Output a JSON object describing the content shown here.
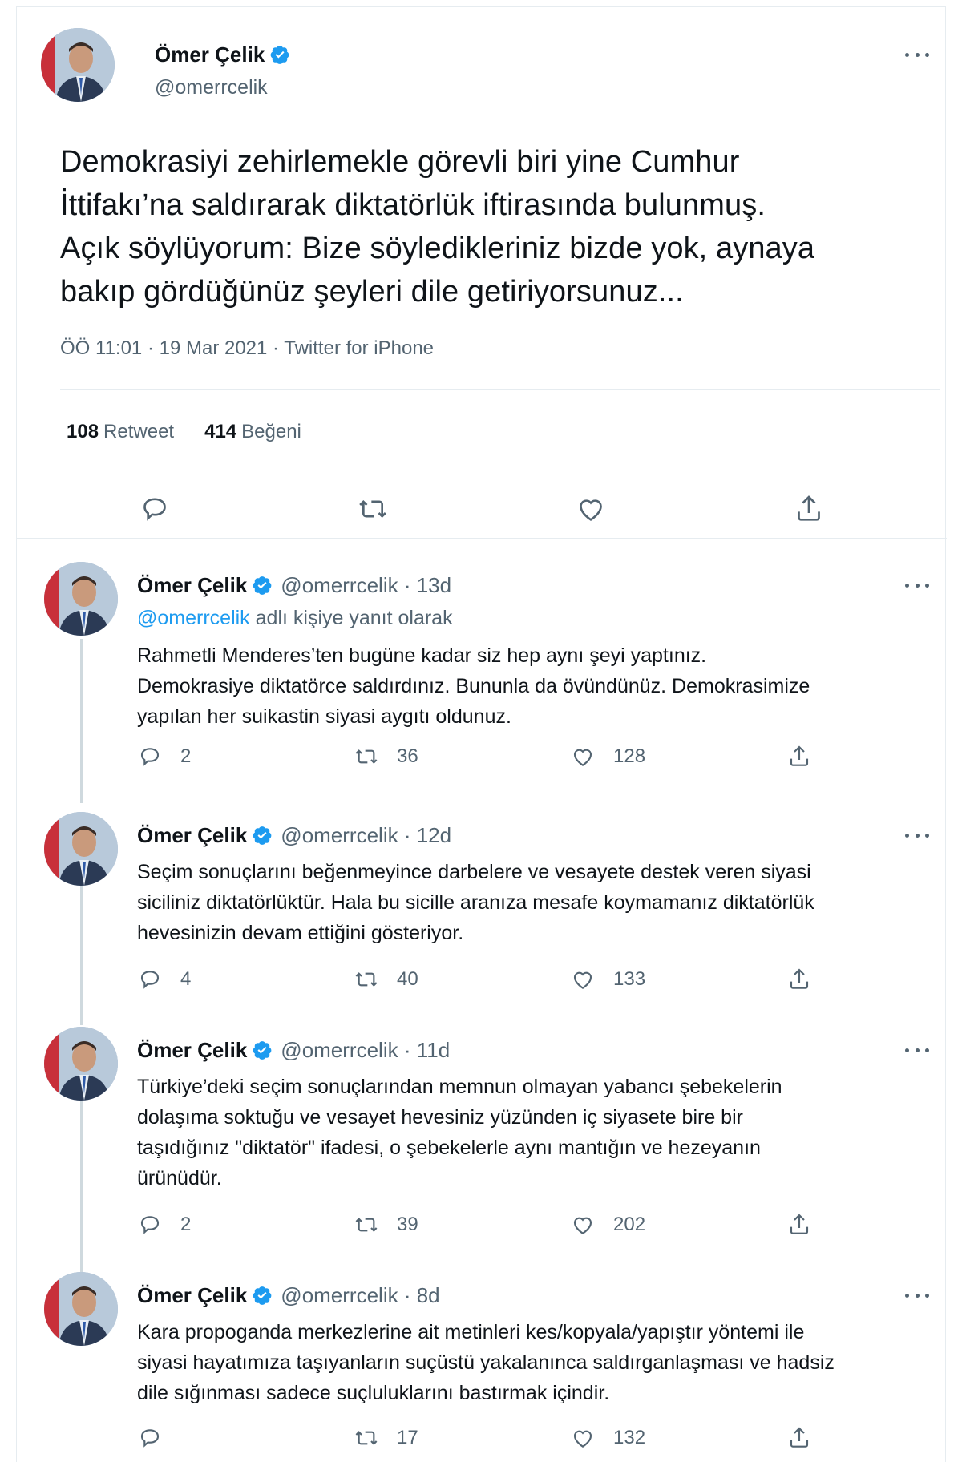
{
  "colors": {
    "text": "#0f1419",
    "muted": "#536471",
    "link": "#1d9bf0",
    "verified": "#1d9bf0",
    "border": "#e6ecf0"
  },
  "main_tweet": {
    "name": "Ömer Çelik",
    "handle": "@omerrcelik",
    "text_lines": [
      "Demokrasiyi zehirlemekle görevli biri yine Cumhur",
      "İttifakı’na saldırarak diktatörlük iftirasında bulunmuş.",
      "Açık söylüyorum: Bize söyledikleriniz bizde yok, aynaya",
      "bakıp gördüğünüz şeyleri dile getiriyorsunuz..."
    ],
    "meta": "ÖÖ 11:01 · 19 Mar 2021 · Twitter for iPhone",
    "retweets": {
      "count": "108",
      "label": "Retweet"
    },
    "likes": {
      "count": "414",
      "label": "Beğeni"
    },
    "icons": [
      "reply-icon",
      "retweet-icon",
      "like-icon",
      "share-icon"
    ]
  },
  "replies": [
    {
      "name": "Ömer Çelik",
      "handle": "@omerrcelik · 13d",
      "replying_to": {
        "link": "@omerrcelik",
        "text": " adlı kişiye yanıt olarak"
      },
      "text_lines": [
        "Rahmetli Menderes’ten bugüne kadar siz hep aynı şeyi yaptınız.",
        "Demokrasiye diktatörce saldırdınız. Bununla da övündünüz. Demokrasimize",
        "yapılan her suikastin siyasi aygıtı oldunuz."
      ],
      "replies": "2",
      "retweets": "36",
      "likes": "128"
    },
    {
      "name": "Ömer Çelik",
      "handle": "@omerrcelik · 12d",
      "text_lines": [
        "Seçim sonuçlarını beğenmeyince darbelere ve vesayete destek veren siyasi",
        "siciliniz diktatörlüktür. Hala bu sicille aranıza mesafe koymamanız diktatörlük",
        "hevesinizin devam ettiğini gösteriyor."
      ],
      "replies": "4",
      "retweets": "40",
      "likes": "133"
    },
    {
      "name": "Ömer Çelik",
      "handle": "@omerrcelik · 11d",
      "text_lines": [
        "Türkiye’deki seçim sonuçlarından memnun olmayan yabancı şebekelerin",
        "dolaşıma soktuğu ve vesayet hevesiniz yüzünden iç siyasete bire bir",
        "taşıdığınız \"diktatör\" ifadesi, o şebekelerle aynı mantığın ve hezeyanın",
        "ürünüdür."
      ],
      "replies": "2",
      "retweets": "39",
      "likes": "202"
    },
    {
      "name": "Ömer Çelik",
      "handle": "@omerrcelik · 8d",
      "text_lines": [
        "Kara propoganda merkezlerine ait metinleri kes/kopyala/yapıştır yöntemi ile",
        "siyasi hayatımıza taşıyanların suçüstü yakalanınca saldırganlaşması ve hadsiz",
        "dile sığınması sadece suçluluklarını bastırmak içindir."
      ],
      "replies": "",
      "retweets": "17",
      "likes": "132"
    }
  ]
}
